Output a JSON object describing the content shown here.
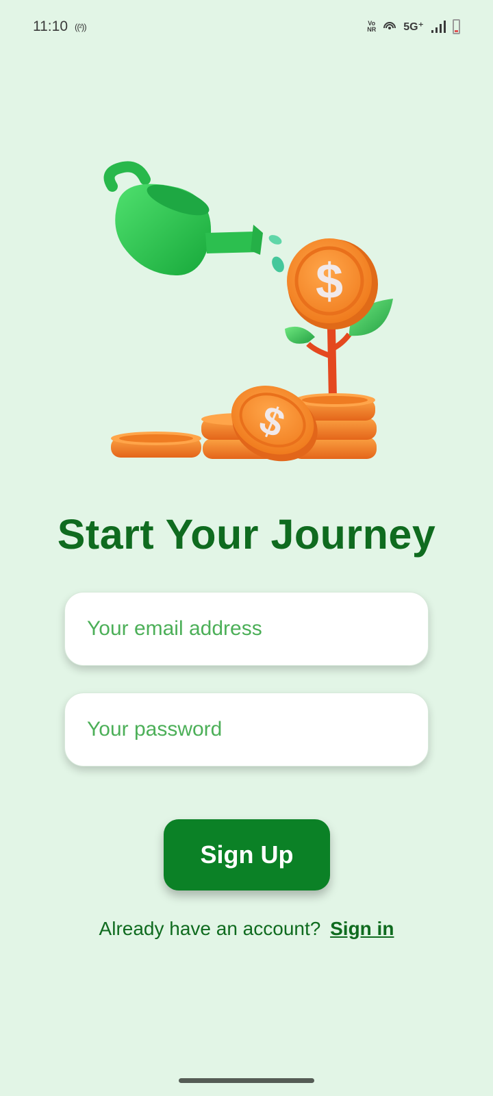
{
  "status_bar": {
    "time": "11:10",
    "hotspot": "((²))",
    "network_vonr_top": "Vo",
    "network_vonr_bottom": "NR",
    "network_type": "5G⁺"
  },
  "main": {
    "title": "Start Your Journey",
    "email_placeholder": "Your email address",
    "password_placeholder": "Your password",
    "signup_label": "Sign Up",
    "signin_prompt": "Already have an account?",
    "signin_link": "Sign in"
  },
  "colors": {
    "background": "#e2f5e6",
    "brand_green": "#0b8126",
    "title_green": "#0f6b1f",
    "placeholder_green": "#4caf58",
    "coin_orange": "#f08a24"
  },
  "icons": [
    "watering-can-icon",
    "money-plant-icon",
    "coin-stack-icon",
    "signal-icon",
    "battery-icon",
    "hotspot-icon"
  ]
}
